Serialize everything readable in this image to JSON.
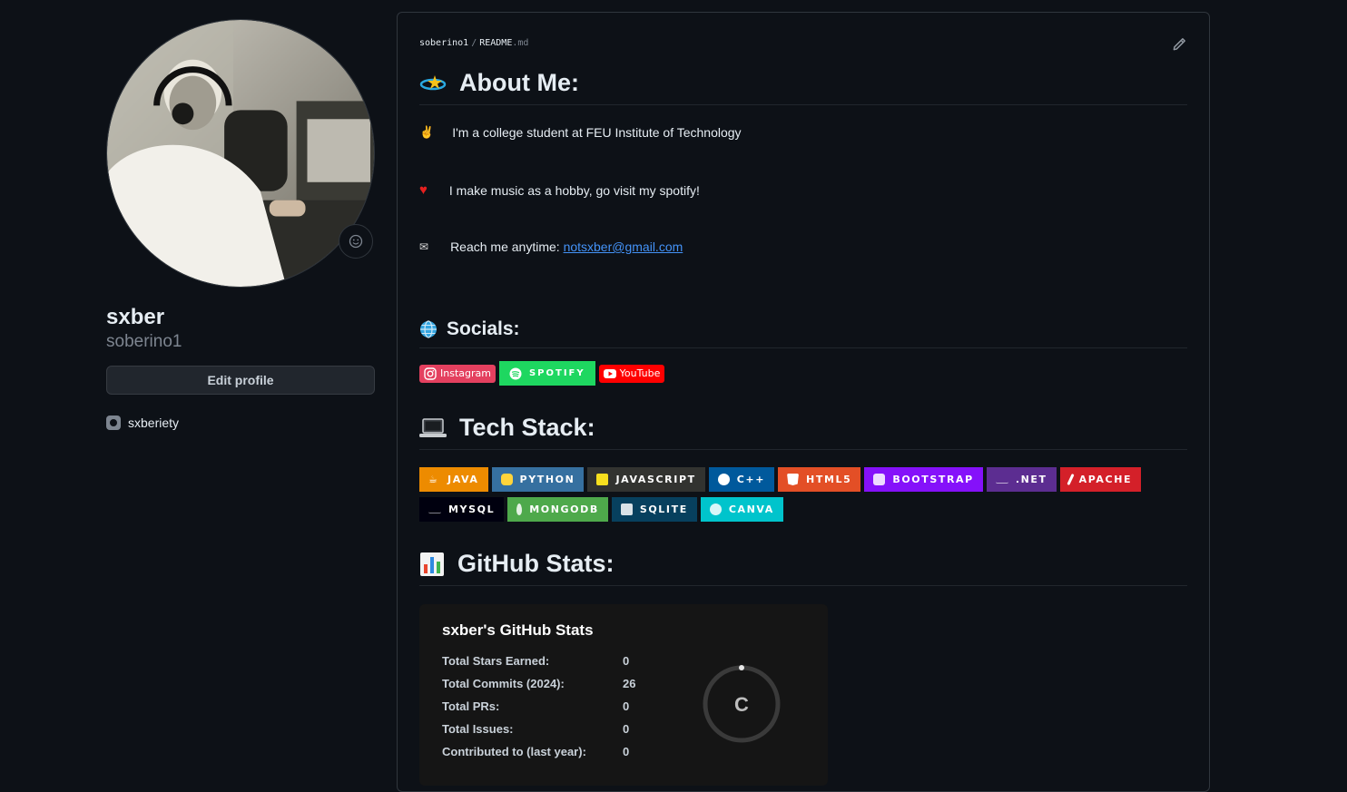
{
  "profile": {
    "display_name": "sxber",
    "login": "soberino1",
    "edit_profile_label": "Edit profile",
    "social_link": "sxberiety"
  },
  "readme": {
    "repo": "soberino1",
    "separator": "/",
    "file_base": "README",
    "file_ext": ".md",
    "about_heading": "About Me:",
    "about_lines": [
      {
        "icon": "✌",
        "text": "I'm a college student at FEU Institute of Technology"
      },
      {
        "icon": "♥",
        "text": "I make music as a hobby, go visit my spotify!"
      },
      {
        "icon": "✉",
        "text": "Reach me anytime: ",
        "link": "notsxber@gmail.com"
      }
    ],
    "socials_heading": "Socials:",
    "social_badges": [
      {
        "label": "Instagram",
        "color": "#e4405f"
      },
      {
        "label": "SPOTIFY",
        "color": "#1ed760"
      },
      {
        "label": "YouTube",
        "color": "#ff0000"
      }
    ],
    "tech_heading": "Tech Stack:",
    "tech_row1": [
      {
        "label": "JAVA",
        "color": "#ed8b00"
      },
      {
        "label": "PYTHON",
        "color": "#3670a0"
      },
      {
        "label": "JAVASCRIPT",
        "color": "#323330"
      },
      {
        "label": "C++",
        "color": "#00599c"
      },
      {
        "label": "HTML5",
        "color": "#e34f26"
      },
      {
        "label": "BOOTSTRAP",
        "color": "#8511fa"
      },
      {
        "label": ".NET",
        "color": "#5c2d91"
      },
      {
        "label": "APACHE",
        "color": "#d42029"
      }
    ],
    "tech_row2": [
      {
        "label": "MYSQL",
        "color": "#00000f"
      },
      {
        "label": "MONGODB",
        "color": "#4ea94b"
      },
      {
        "label": "SQLITE",
        "color": "#07405e"
      },
      {
        "label": "CANVA",
        "color": "#00c4cc"
      }
    ],
    "stats_heading": "GitHub Stats:"
  },
  "stats": {
    "title": "sxber's GitHub Stats",
    "rows": [
      {
        "label": "Total Stars Earned:",
        "value": "0"
      },
      {
        "label": "Total Commits (2024):",
        "value": "26"
      },
      {
        "label": "Total PRs:",
        "value": "0"
      },
      {
        "label": "Total Issues:",
        "value": "0"
      },
      {
        "label": "Contributed to (last year):",
        "value": "0"
      }
    ],
    "rank": "C"
  }
}
